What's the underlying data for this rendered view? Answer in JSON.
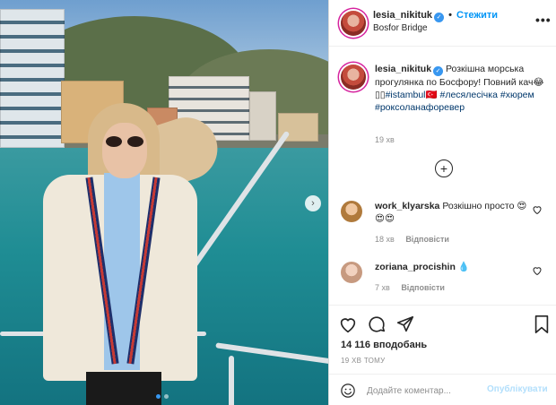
{
  "post": {
    "photo_alt": "",
    "slide_count": 2,
    "active_slide": 1
  },
  "header": {
    "username": "lesia_nikituk",
    "verified_icon": "verified-badge-icon",
    "separator": "•",
    "follow_label": "Стежити",
    "location": "Bosfor Bridge",
    "more_icon": "more-options-icon"
  },
  "caption": {
    "username": "lesia_nikituk",
    "text": "Розкішна морська прогулянка по Босфору! Повний кач😂",
    "emoji_extra": "▯▯",
    "hashtags": [
      "#istambul🇹🇷",
      "#лесялесічка",
      "#хюрем",
      "#роксоланафоревер"
    ],
    "time": "19 хв"
  },
  "load_more_icon": "plus-circle-icon",
  "comments": [
    {
      "username": "work_klyarska",
      "text": "Розкішно просто 😍😍😍",
      "time": "18 хв",
      "reply_label": "Відповісти"
    },
    {
      "username": "zoriana_procishin",
      "text": "💧",
      "time": "7 хв",
      "reply_label": "Відповісти"
    }
  ],
  "actions": {
    "like_icon": "heart-icon",
    "comment_icon": "comment-icon",
    "share_icon": "send-icon",
    "save_icon": "bookmark-icon",
    "likes_text": "14 116 вподобань",
    "posted_ago": "19 ХВ ТОМУ"
  },
  "add_comment": {
    "emoji_icon": "smiley-icon",
    "placeholder": "Додайте коментар...",
    "post_label": "Опублікувати"
  },
  "colors": {
    "accent": "#0095f6",
    "verified": "#3897f0",
    "post_disabled": "#b2dffc",
    "muted": "#8e8e8e",
    "text": "#262626",
    "border": "#dbdbdb"
  }
}
